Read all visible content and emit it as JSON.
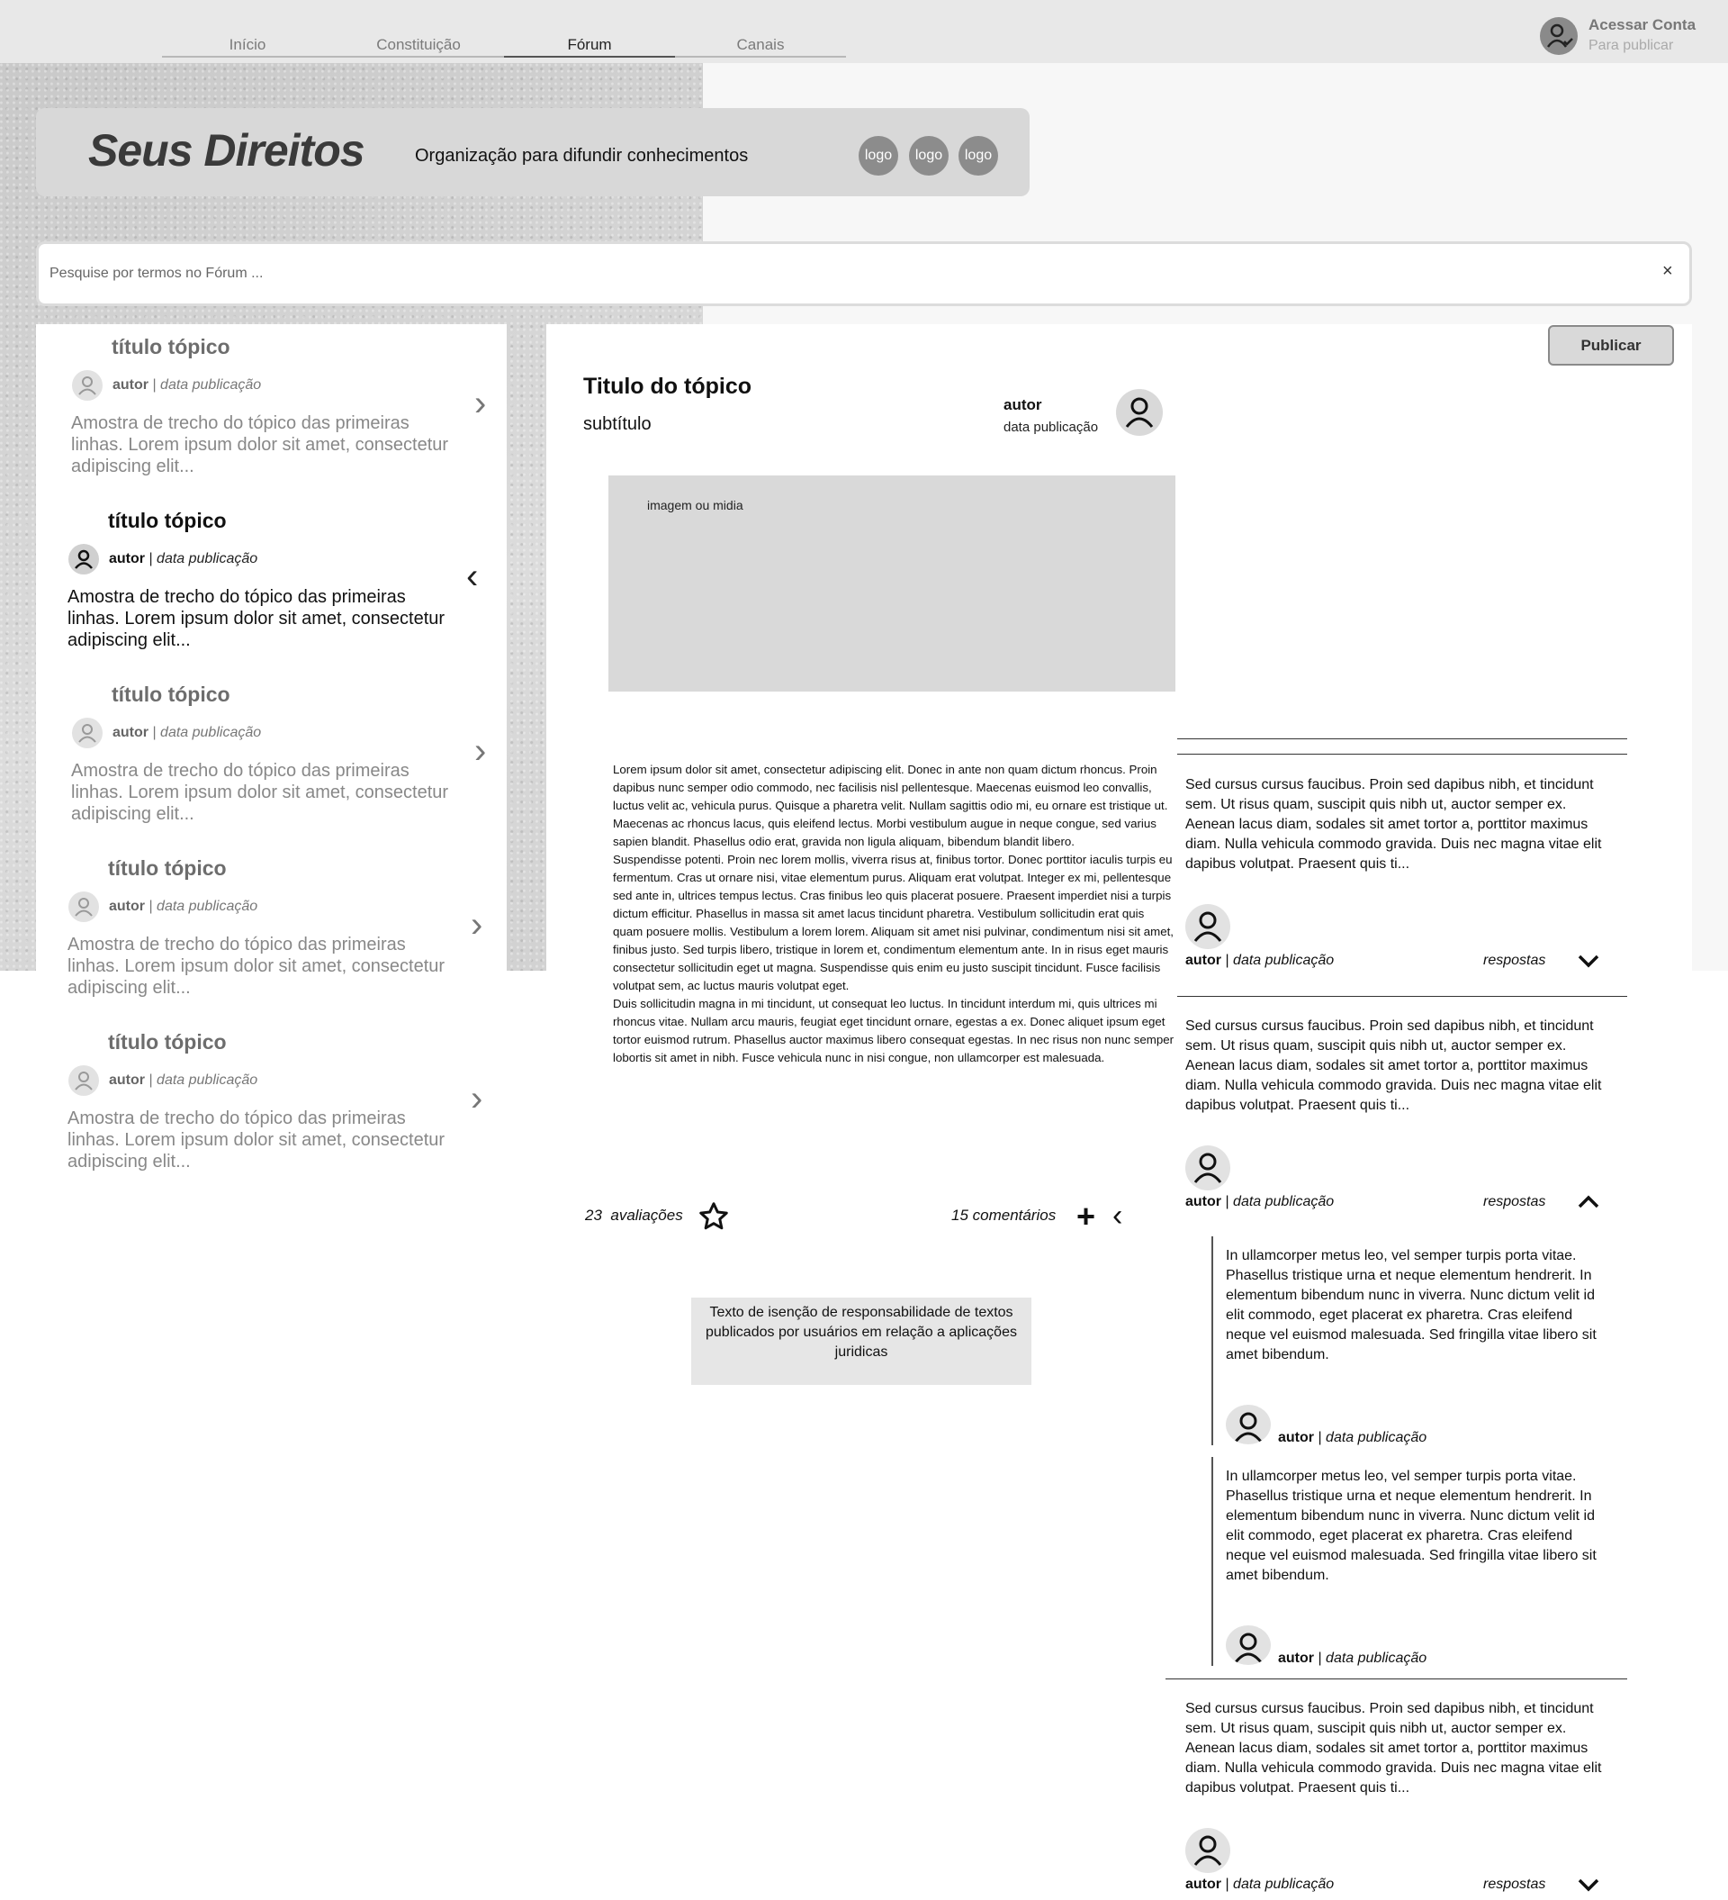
{
  "nav": {
    "tabs": [
      "Início",
      "Constituição",
      "Fórum",
      "Canais"
    ],
    "active": "Fórum"
  },
  "account": {
    "title": "Acessar Conta",
    "subtitle": "Para publicar",
    "icon": "user-check-icon"
  },
  "header": {
    "brand": "Seus Direitos",
    "tagline": "Organização para difundir conhecimentos",
    "logos": [
      "logo",
      "logo",
      "logo"
    ]
  },
  "search": {
    "placeholder": "Pesquise por termos no Fórum ...",
    "clear_label": "×"
  },
  "topics": [
    {
      "title": "título tópico",
      "author": "autor",
      "date": "data publicação",
      "excerpt": "Amostra de trecho do tópico das primeiras linhas. Lorem ipsum dolor sit amet, consectetur adipiscing elit...",
      "active": false
    },
    {
      "title": "título tópico",
      "author": "autor",
      "date": "data publicação",
      "excerpt": "Amostra de trecho do tópico das primeiras linhas. Lorem ipsum dolor sit amet, consectetur adipiscing elit...",
      "active": true
    },
    {
      "title": "título tópico",
      "author": "autor",
      "date": "data publicação",
      "excerpt": "Amostra de trecho do tópico das primeiras linhas. Lorem ipsum dolor sit amet, consectetur adipiscing elit...",
      "active": false
    },
    {
      "title": "título tópico",
      "author": "autor",
      "date": "data publicação",
      "excerpt": "Amostra de trecho do tópico das primeiras linhas. Lorem ipsum dolor sit amet, consectetur adipiscing elit...",
      "active": false
    },
    {
      "title": "título tópico",
      "author": "autor",
      "date": "data publicação",
      "excerpt": "Amostra de trecho do tópico das primeiras linhas. Lorem ipsum dolor sit amet, consectetur adipiscing elit...",
      "active": false
    }
  ],
  "main": {
    "publish_label": "Publicar",
    "title": "Titulo do tópico",
    "subtitle": "subtítulo",
    "author": "autor",
    "date": "data publicação",
    "media_label": "imagem ou midia",
    "body": " Lorem ipsum dolor sit amet, consectetur adipiscing elit. Donec in ante  non quam dictum rhoncus. Proin dapibus nunc semper odio commodo, nec  facilisis nisl pellentesque. Maecenas euismod leo convallis, luctus  velit ac, vehicula purus. Quisque a pharetra velit. Nullam sagittis odio mi, eu ornare est tristique ut. Maecenas ac rhoncus lacus, quis  eleifend lectus. Morbi vestibulum augue in neque congue, sed varius  sapien blandit. Phasellus odio erat, gravida non ligula aliquam,  bibendum blandit libero.\n Suspendisse potenti. Proin nec lorem mollis, viverra risus at, finibus  tortor. Donec porttitor iaculis turpis eu fermentum. Cras ut ornare  nisi, vitae elementum purus. Aliquam erat volutpat. Integer ex mi,  pellentesque sed ante in, ultrices tempus lectus. Cras finibus leo quis  placerat posuere. Praesent imperdiet nisi a turpis dictum efficitur.  Phasellus in massa sit amet lacus tincidunt pharetra. Vestibulum  sollicitudin erat quis quam posuere mollis. Vestibulum a lorem lorem.  Aliquam sit amet nisi pulvinar, condimentum nisi sit amet, finibus  justo. Sed turpis libero, tristique in lorem et, condimentum elementum  ante. In in risus eget mauris consectetur sollicitudin eget ut magna.  Suspendisse quis enim eu justo suscipit tincidunt. Fusce facilisis volutpat sem, ac luctus mauris volutpat eget.\n Duis sollicitudin magna in mi tincidunt, ut consequat leo luctus. In  tincidunt interdum mi, quis ultrices mi rhoncus vitae. Nullam arcu  mauris, feugiat eget tincidunt ornare, egestas a ex. Donec aliquet ipsum eget tortor euismod rutrum. Phasellus auctor maximus libero consequat egestas. In nec risus non nunc semper lobortis sit amet in nibh. Fusce  vehicula nunc in nisi congue, non ullamcorper est malesuada.",
    "ratings_count": "23",
    "ratings_label": "avaliações",
    "comments_count": "15",
    "comments_label": "comentários",
    "disclaimer": "Texto de isenção de responsabilidade de textos publicados por usuários em relação a aplicações juridicas"
  },
  "comments": [
    {
      "text": "Sed cursus cursus faucibus. Proin sed dapibus nibh, et tincidunt sem. Ut risus quam, suscipit quis nibh ut, auctor semper ex. Aenean lacus diam, sodales sit amet tortor a, porttitor maximus diam. Nulla vehicula  commodo gravida. Duis nec magna vitae elit dapibus volutpat. Praesent  quis ti...",
      "author": "autor",
      "date": "data publicação",
      "replies_label": "respostas",
      "expanded": false
    },
    {
      "text": "Sed cursus cursus faucibus. Proin sed dapibus nibh, et tincidunt sem. Ut risus quam, suscipit quis nibh ut, auctor semper ex. Aenean lacus diam, sodales sit amet tortor a, porttitor maximus diam. Nulla vehicula  commodo gravida. Duis nec magna vitae elit dapibus volutpat. Praesent  quis ti...",
      "author": "autor",
      "date": "data publicação",
      "replies_label": "respostas",
      "expanded": true,
      "replies": [
        {
          "text": "In ullamcorper metus leo, vel semper turpis porta vitae. Phasellus  tristique urna et neque elementum hendrerit. In elementum bibendum nunc  in viverra. Nunc dictum velit id elit commodo, eget placerat ex  pharetra. Cras eleifend neque vel euismod malesuada. Sed fringilla vitae libero sit amet bibendum.",
          "author": "autor",
          "date": "data publicação"
        },
        {
          "text": "In ullamcorper metus leo, vel semper turpis porta vitae. Phasellus  tristique urna et neque elementum hendrerit. In elementum bibendum nunc  in viverra. Nunc dictum velit id elit commodo, eget placerat ex  pharetra. Cras eleifend neque vel euismod malesuada. Sed fringilla vitae libero sit amet bibendum.",
          "author": "autor",
          "date": "data publicação"
        }
      ]
    },
    {
      "text": "Sed cursus cursus faucibus. Proin sed dapibus nibh, et tincidunt sem. Ut risus quam, suscipit quis nibh ut, auctor semper ex. Aenean lacus diam, sodales sit amet tortor a, porttitor maximus diam. Nulla vehicula  commodo gravida. Duis nec magna vitae elit dapibus volutpat. Praesent  quis ti...",
      "author": "autor",
      "date": "data publicação",
      "replies_label": "respostas",
      "expanded": false
    }
  ],
  "icons": {
    "chevron_right": "chevron-right-icon",
    "chevron_left": "chevron-left-icon",
    "star": "star-icon",
    "plus": "plus-icon",
    "user": "user-icon"
  }
}
